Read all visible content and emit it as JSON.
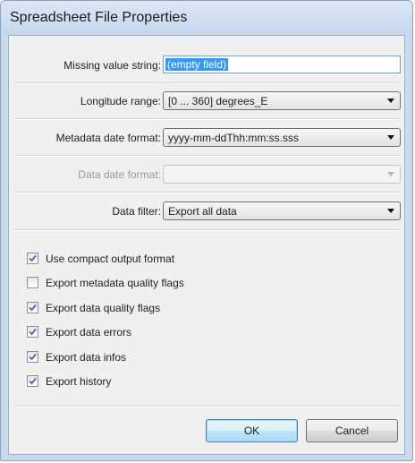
{
  "window": {
    "title": "Spreadsheet File Properties"
  },
  "fields": {
    "missing_value": {
      "label": "Missing value string:",
      "value": "(empty field)"
    },
    "longitude_range": {
      "label": "Longitude range:",
      "value": "[0 ... 360] degrees_E"
    },
    "metadata_date_format": {
      "label": "Metadata date format:",
      "value": "yyyy-mm-ddThh:mm:ss.sss"
    },
    "data_date_format": {
      "label": "Data date format:",
      "value": "",
      "enabled": false
    },
    "data_filter": {
      "label": "Data filter:",
      "value": "Export all data"
    }
  },
  "options": [
    {
      "label": "Use compact output format",
      "checked": true
    },
    {
      "label": "Export metadata quality flags",
      "checked": false
    },
    {
      "label": "Export data quality flags",
      "checked": true
    },
    {
      "label": "Export data errors",
      "checked": true
    },
    {
      "label": "Export data infos",
      "checked": true
    },
    {
      "label": "Export history",
      "checked": true
    }
  ],
  "buttons": {
    "ok": "OK",
    "cancel": "Cancel"
  },
  "colors": {
    "selection": "#3399ff",
    "frame": "#c9daee",
    "check": "#3a6fb7"
  },
  "icons": {
    "dropdown": "chevron-down-icon",
    "check": "check-icon"
  }
}
